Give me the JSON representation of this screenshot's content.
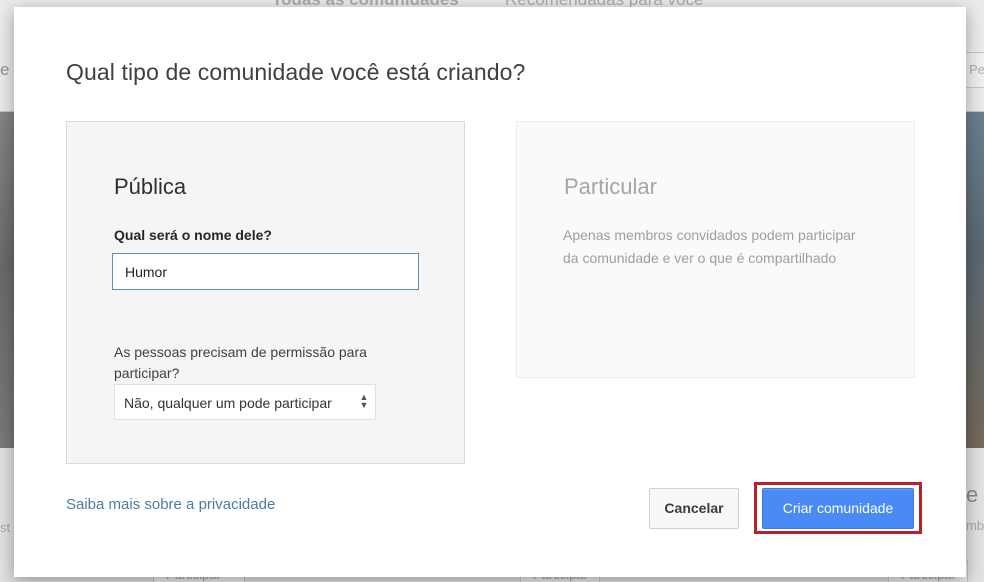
{
  "background": {
    "tabs": [
      "Todas as comunidades",
      "Recomendadas para você"
    ],
    "left_edge_text": "e",
    "search_hint": "Pe",
    "left_low_text": "st",
    "right_big_text": "e",
    "right_low_text": "mb",
    "join_labels": [
      "Participar",
      "Participar",
      "Participar"
    ]
  },
  "dialog": {
    "title": "Qual tipo de comunidade você está criando?",
    "public_card": {
      "heading": "Pública",
      "name_label": "Qual será o nome dele?",
      "name_value": "Humor",
      "permission_label": "As pessoas precisam de permissão para participar?",
      "permission_selected": "Não, qualquer um pode participar"
    },
    "private_card": {
      "heading": "Particular",
      "description": "Apenas membros convidados podem participar da comunidade e ver o que é compartilhado"
    },
    "privacy_link": "Saiba mais sobre a privacidade",
    "cancel_label": "Cancelar",
    "create_label": "Criar comunidade"
  },
  "colors": {
    "primary_button": "#4a8af4",
    "highlight_frame": "#b1222c",
    "link": "#4a7ea3",
    "input_border": "#5b8ec8"
  },
  "icons": {
    "select_arrows": "up-down-arrows-icon"
  }
}
